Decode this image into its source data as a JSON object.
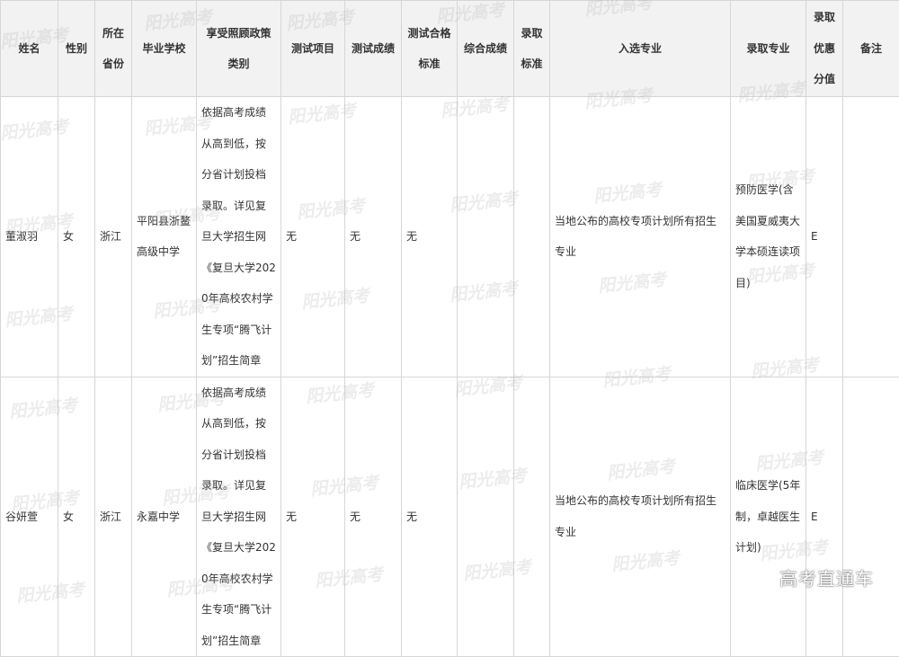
{
  "headers": [
    "姓名",
    "性别",
    "所在省份",
    "毕业学校",
    "享受照顾政策类别",
    "测试项目",
    "测试成绩",
    "测试合格标准",
    "综合成绩",
    "录取标准",
    "入选专业",
    "录取专业",
    "录取优惠分值",
    "备注"
  ],
  "rows": [
    [
      "董淑羽",
      "女",
      "浙江",
      "平阳县浙鳌高级中学",
      "依据高考成绩从高到低，按分省计划投档录取。详见复旦大学招生网《复旦大学2020年高校农村学生专项“腾飞计划”招生简章",
      "无",
      "无",
      "无",
      "",
      "",
      "当地公布的高校专项计划所有招生专业",
      "预防医学(含美国夏威夷大学本硕连读项目)",
      "E",
      ""
    ],
    [
      "谷妍萱",
      "女",
      "浙江",
      "永嘉中学",
      "依据高考成绩从高到低，按分省计划投档录取。详见复旦大学招生网《复旦大学2020年高校农村学生专项“腾飞计划”招生简章",
      "无",
      "无",
      "无",
      "",
      "",
      "当地公布的高校专项计划所有招生专业",
      "临床医学(5年制，卓越医生计划)",
      "E",
      ""
    ]
  ],
  "watermark_text": "阳光高考",
  "brand_text": "高考直通车"
}
